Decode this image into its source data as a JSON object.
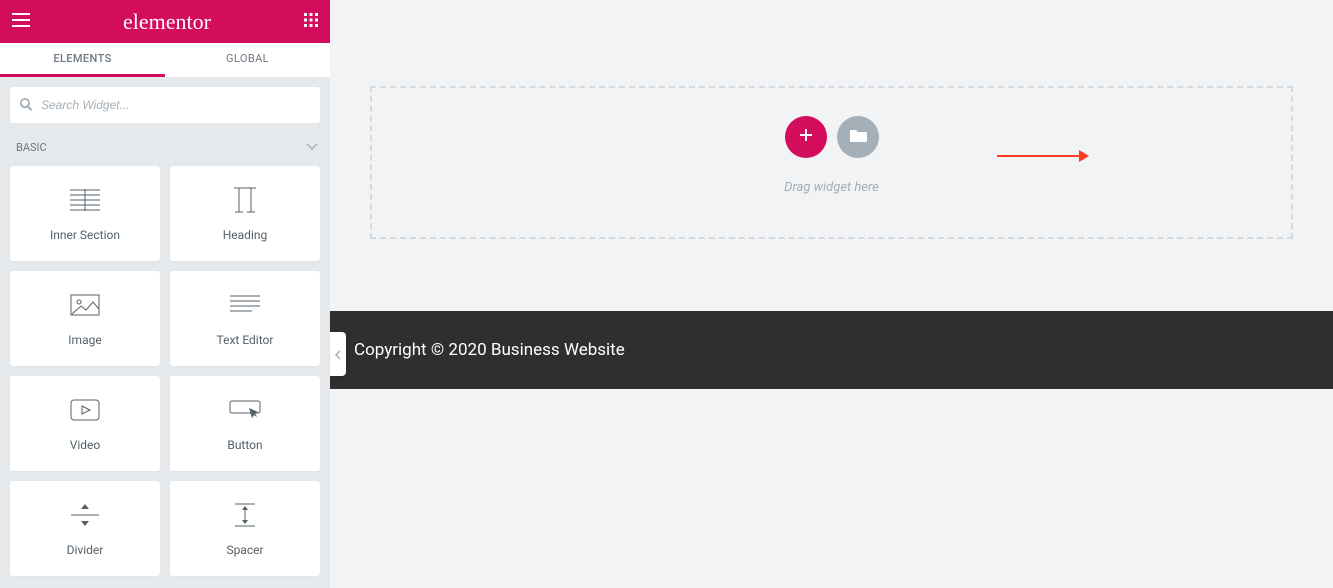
{
  "colors": {
    "accent": "#d30c5c",
    "footer_bg": "#2f2f2f"
  },
  "sidebar": {
    "logo": "elementor",
    "tabs": [
      {
        "label": "ELEMENTS",
        "active": true
      },
      {
        "label": "GLOBAL",
        "active": false
      }
    ],
    "search": {
      "placeholder": "Search Widget..."
    },
    "category": "BASIC",
    "widgets": [
      {
        "label": "Inner Section",
        "icon": "inner-section"
      },
      {
        "label": "Heading",
        "icon": "heading"
      },
      {
        "label": "Image",
        "icon": "image"
      },
      {
        "label": "Text Editor",
        "icon": "text-editor"
      },
      {
        "label": "Video",
        "icon": "video"
      },
      {
        "label": "Button",
        "icon": "button"
      },
      {
        "label": "Divider",
        "icon": "divider"
      },
      {
        "label": "Spacer",
        "icon": "spacer"
      }
    ]
  },
  "canvas": {
    "drop_label": "Drag widget here",
    "footer_text": "Copyright © 2020 Business Website"
  }
}
